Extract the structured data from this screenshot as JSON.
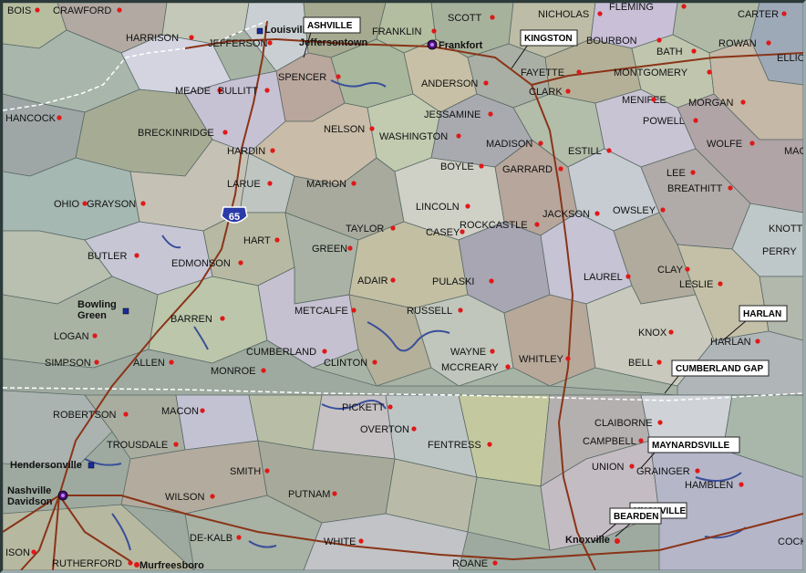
{
  "map": {
    "highway_shield": "65",
    "counties": [
      {
        "name": "BOIS"
      },
      {
        "name": "CRAWFORD"
      },
      {
        "name": "HARRISON"
      },
      {
        "name": "JEFFERSON"
      },
      {
        "name": "FRANKLIN"
      },
      {
        "name": "SCOTT"
      },
      {
        "name": "NICHOLAS"
      },
      {
        "name": "FLEMING"
      },
      {
        "name": "CARTER"
      },
      {
        "name": "BOURBON"
      },
      {
        "name": "BATH"
      },
      {
        "name": "ROWAN"
      },
      {
        "name": "ELLIOTT"
      },
      {
        "name": "SPENCER"
      },
      {
        "name": "ANDERSON"
      },
      {
        "name": "FAYETTE"
      },
      {
        "name": "MONTGOMERY"
      },
      {
        "name": "MEADE"
      },
      {
        "name": "BULLITT"
      },
      {
        "name": "CLARK"
      },
      {
        "name": "MENIFEE"
      },
      {
        "name": "MORGAN"
      },
      {
        "name": "HANCOCK"
      },
      {
        "name": "JESSAMINE"
      },
      {
        "name": "POWELL"
      },
      {
        "name": "BRECKINRIDGE"
      },
      {
        "name": "NELSON"
      },
      {
        "name": "WASHINGTON"
      },
      {
        "name": "MADISON"
      },
      {
        "name": "WOLFE"
      },
      {
        "name": "HARDIN"
      },
      {
        "name": "ESTILL"
      },
      {
        "name": "MAGOFFIN"
      },
      {
        "name": "BOYLE"
      },
      {
        "name": "GARRARD"
      },
      {
        "name": "LEE"
      },
      {
        "name": "LARUE"
      },
      {
        "name": "MARION"
      },
      {
        "name": "BREATHITT"
      },
      {
        "name": "OHIO"
      },
      {
        "name": "GRAYSON"
      },
      {
        "name": "LINCOLN"
      },
      {
        "name": "JACKSON"
      },
      {
        "name": "OWSLEY"
      },
      {
        "name": "TAYLOR"
      },
      {
        "name": "ROCKCASTLE"
      },
      {
        "name": "KNOTT"
      },
      {
        "name": "HART"
      },
      {
        "name": "CASEY"
      },
      {
        "name": "GREEN"
      },
      {
        "name": "PERRY"
      },
      {
        "name": "BUTLER"
      },
      {
        "name": "EDMONSON"
      },
      {
        "name": "CLAY"
      },
      {
        "name": "ADAIR"
      },
      {
        "name": "PULASKI"
      },
      {
        "name": "LAUREL"
      },
      {
        "name": "LESLIE"
      },
      {
        "name": "BARREN"
      },
      {
        "name": "METCALFE"
      },
      {
        "name": "RUSSELL"
      },
      {
        "name": "KNOX"
      },
      {
        "name": "LOGAN"
      },
      {
        "name": "CUMBERLAND"
      },
      {
        "name": "WAYNE"
      },
      {
        "name": "SIMPSON"
      },
      {
        "name": "ALLEN"
      },
      {
        "name": "MONROE"
      },
      {
        "name": "CLINTON"
      },
      {
        "name": "MCCREARY"
      },
      {
        "name": "WHITLEY"
      },
      {
        "name": "BELL"
      },
      {
        "name": "HARLAN"
      },
      {
        "name": "ROBERTSON"
      },
      {
        "name": "MACON"
      },
      {
        "name": "PICKETT"
      },
      {
        "name": "OVERTON"
      },
      {
        "name": "CLAIBORNE"
      },
      {
        "name": "TROUSDALE"
      },
      {
        "name": "FENTRESS"
      },
      {
        "name": "CAMPBELL"
      },
      {
        "name": "SMITH"
      },
      {
        "name": "UNION"
      },
      {
        "name": "GRAINGER"
      },
      {
        "name": "HAMBLEN"
      },
      {
        "name": "WILSON"
      },
      {
        "name": "PUTNAM"
      },
      {
        "name": "DE-KALB"
      },
      {
        "name": "WHITE"
      },
      {
        "name": "COCKE"
      },
      {
        "name": "ISON"
      },
      {
        "name": "RUTHERFORD"
      },
      {
        "name": "ROANE"
      }
    ],
    "cities": [
      {
        "name": "Louisville"
      },
      {
        "name": "Frankfort"
      },
      {
        "name": "Jeffersontown"
      },
      {
        "name": "Bowling Green"
      },
      {
        "name": "Hendersonville"
      },
      {
        "name": "Nashville Davidson"
      },
      {
        "name": "Murfreesboro"
      },
      {
        "name": "Knoxville"
      }
    ],
    "callouts": [
      {
        "label": "ASHVILLE"
      },
      {
        "label": "KINGSTON"
      },
      {
        "label": "HARLAN"
      },
      {
        "label": "CUMBERLAND GAP"
      },
      {
        "label": "MAYNARDSVILLE"
      },
      {
        "label": "KNOXVILLE"
      },
      {
        "label": "BEARDEN"
      }
    ],
    "colors": {
      "county_dot": "#e01818",
      "city_dot": "#1a2aa0",
      "capital_ring": "#4a0e7a",
      "interstate": "#8a3418",
      "state_line": "#ffffff",
      "water": "#3a4f9a",
      "shield": "#2a3aa8"
    }
  }
}
